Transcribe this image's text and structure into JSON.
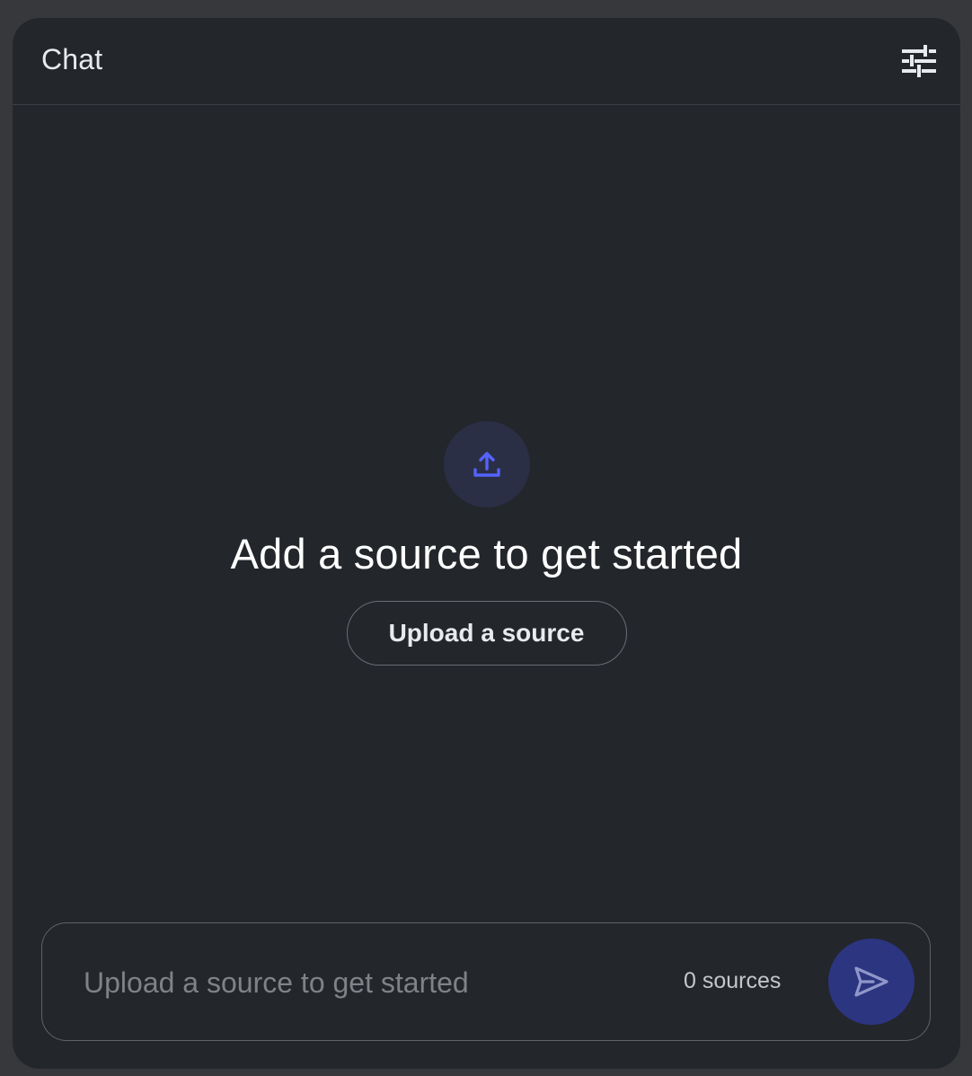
{
  "header": {
    "title": "Chat",
    "settings_icon": "tune-sliders-icon"
  },
  "empty_state": {
    "icon": "upload-icon",
    "heading": "Add a source to get started",
    "button_label": "Upload a source"
  },
  "composer": {
    "placeholder": "Upload a source to get started",
    "value": "",
    "source_count": "0 sources",
    "send_icon": "send-icon"
  },
  "colors": {
    "background": "#37383b",
    "panel": "#23262b",
    "accent": "#5563ff",
    "send_button": "#2c3580",
    "upload_circle": "#2b2f45"
  }
}
